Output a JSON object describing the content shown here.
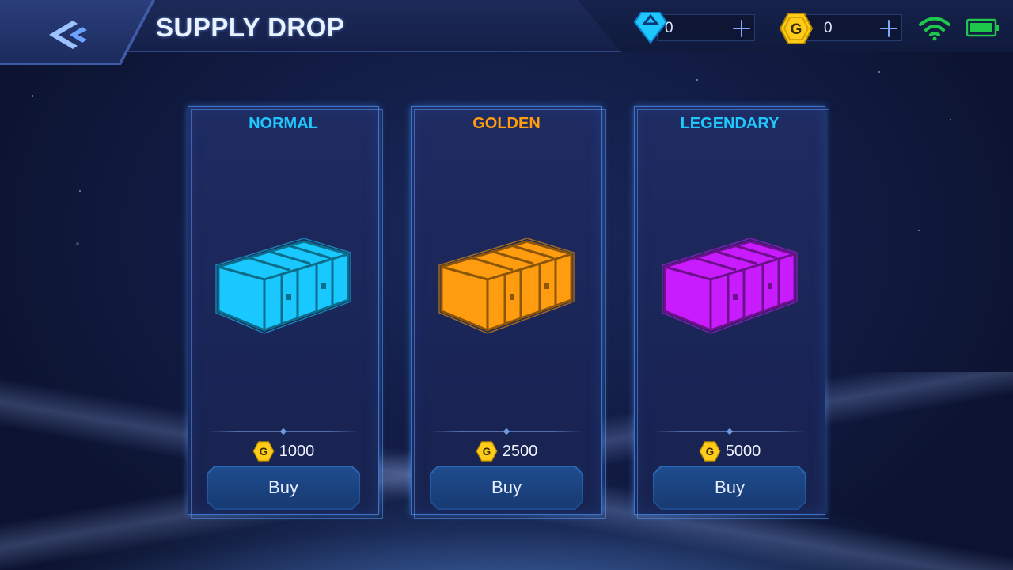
{
  "header": {
    "title": "SUPPLY DROP"
  },
  "currencies": {
    "gems": {
      "icon": "diamond-icon",
      "value": "0"
    },
    "gold": {
      "icon": "gold-coin-icon",
      "value": "0"
    }
  },
  "status": {
    "wifi_icon": "wifi-icon",
    "battery_icon": "battery-icon"
  },
  "crates": [
    {
      "name": "NORMAL",
      "color": "#18c8ff",
      "price": "1000",
      "buy_label": "Buy"
    },
    {
      "name": "GOLDEN",
      "color": "#ff9c10",
      "price": "2500",
      "buy_label": "Buy"
    },
    {
      "name": "LEGENDARY",
      "color": "#c81cff",
      "price": "5000",
      "buy_label": "Buy"
    }
  ]
}
